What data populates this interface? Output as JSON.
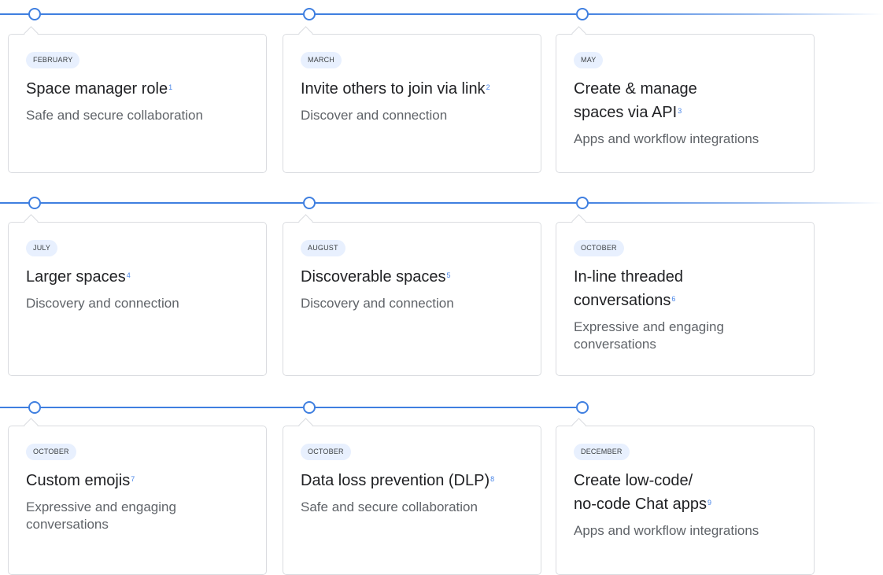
{
  "rows": [
    {
      "cards": [
        {
          "month": "FEBRUARY",
          "title": "Space manager role",
          "note": "1",
          "desc": "Safe and secure collaboration"
        },
        {
          "month": "MARCH",
          "title": "Invite others to join via link",
          "note": "2",
          "desc": "Discover and connection"
        },
        {
          "month": "MAY",
          "title_line1": "Create & manage",
          "title_line2": "spaces via API",
          "note": "3",
          "desc": "Apps and workflow integrations"
        }
      ]
    },
    {
      "cards": [
        {
          "month": "JULY",
          "title": "Larger spaces",
          "note": "4",
          "desc": "Discovery and connection"
        },
        {
          "month": "AUGUST",
          "title": "Discoverable spaces",
          "note": "5",
          "desc": "Discovery and connection"
        },
        {
          "month": "OCTOBER",
          "title_line1": "In-line threaded",
          "title_line2": "conversations",
          "note": "6",
          "desc": "Expressive and engaging conversations"
        }
      ]
    },
    {
      "cards": [
        {
          "month": "OCTOBER",
          "title": "Custom emojis",
          "note": "7",
          "desc": "Expressive and engaging conversations"
        },
        {
          "month": "OCTOBER",
          "title": "Data loss prevention (DLP)",
          "note": "8",
          "desc": "Safe and secure collaboration"
        },
        {
          "month": "DECEMBER",
          "title_line1": "Create low-code/",
          "title_line2": "no-code Chat apps",
          "note": "9",
          "desc": "Apps and workflow integrations"
        }
      ]
    }
  ],
  "colors": {
    "accent": "#3f7fe0",
    "badge_bg": "#e8f0fe",
    "card_border": "#dadce0",
    "footnote": "#4a86e8",
    "muted_text": "#5f6368"
  }
}
